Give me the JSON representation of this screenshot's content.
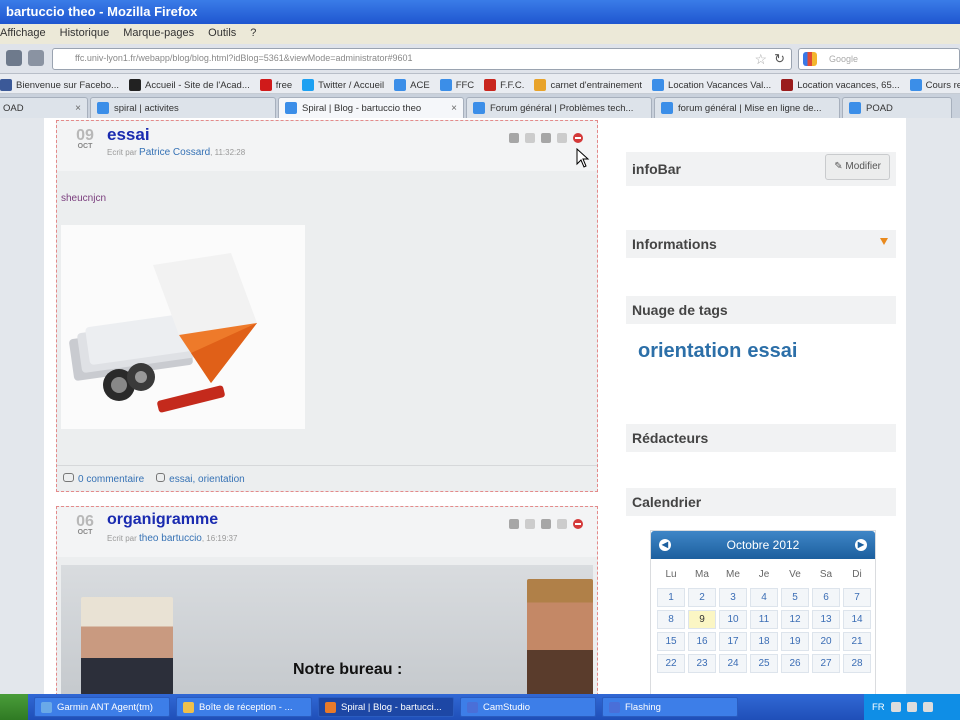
{
  "window": {
    "title": "bartuccio theo - Mozilla Firefox"
  },
  "menu": [
    "Affichage",
    "Historique",
    "Marque-pages",
    "Outils",
    "?"
  ],
  "navbar": {
    "url": "ffc.univ-lyon1.fr/webapp/blog/blog.html?idBlog=5361&viewMode=administrator#9601",
    "search_placeholder": "Google"
  },
  "bookmarks": [
    {
      "label": "Bienvenue sur Facebo...",
      "color": "#3b5998"
    },
    {
      "label": "Accueil - Site de l'Acad...",
      "color": "#222222"
    },
    {
      "label": "free",
      "color": "#d01a1a"
    },
    {
      "label": "Twitter / Accueil",
      "color": "#1da1f2"
    },
    {
      "label": "ACE",
      "color": "#3b8ee8"
    },
    {
      "label": "FFC",
      "color": "#3b8ee8"
    },
    {
      "label": "F.F.C.",
      "color": "#c9261e"
    },
    {
      "label": "carnet d'entrainement",
      "color": "#e8a32a"
    },
    {
      "label": "Location Vacances Val...",
      "color": "#3b8ee8"
    },
    {
      "label": "Location vacances, 65...",
      "color": "#9a1c1c"
    },
    {
      "label": "Cours rem...",
      "color": "#3b8ee8"
    }
  ],
  "tabs": [
    {
      "label": "OAD",
      "active": false
    },
    {
      "label": "spiral | activites",
      "active": false
    },
    {
      "label": "Spiral | Blog - bartuccio theo",
      "active": true
    },
    {
      "label": "Forum général | Problèmes tech...",
      "active": false
    },
    {
      "label": "forum général | Mise en ligne de...",
      "active": false
    },
    {
      "label": "POAD",
      "active": false
    }
  ],
  "posts": [
    {
      "day": "09",
      "month": "OCT",
      "title": "essai",
      "written_by": "Ecrit par",
      "author": "Patrice Cossard",
      "time": ", 11:32:28",
      "body": "sheucnjcn",
      "comments": "0 commentaire",
      "tags": "essai, orientation"
    },
    {
      "day": "06",
      "month": "OCT",
      "title": "organigramme",
      "written_by": "Ecrit par",
      "author": "theo bartuccio",
      "time": ", 16:19:37",
      "banner_text": "Notre bureau :"
    }
  ],
  "sidebar": {
    "infobar": {
      "title": "infoBar",
      "button": "Modifier"
    },
    "informations": {
      "title": "Informations"
    },
    "tags": {
      "title": "Nuage de tags",
      "items": [
        "orientation",
        "essai"
      ]
    },
    "redacteurs": {
      "title": "Rédacteurs"
    },
    "calendar": {
      "title": "Calendrier",
      "month_label": "Octobre 2012",
      "weekdays": [
        "Lu",
        "Ma",
        "Me",
        "Je",
        "Ve",
        "Sa",
        "Di"
      ],
      "days": [
        "1",
        "2",
        "3",
        "4",
        "5",
        "6",
        "7",
        "8",
        "9",
        "10",
        "11",
        "12",
        "13",
        "14",
        "15",
        "16",
        "17",
        "18",
        "19",
        "20",
        "21",
        "22",
        "23",
        "24",
        "25",
        "26",
        "27",
        "28"
      ],
      "today": "9"
    }
  },
  "taskbar": {
    "items": [
      {
        "label": "Garmin ANT Agent(tm)",
        "active": false
      },
      {
        "label": "Boîte de réception - ...",
        "active": false
      },
      {
        "label": "Spiral | Blog - bartucci...",
        "active": true
      },
      {
        "label": "CamStudio",
        "active": false
      },
      {
        "label": "Flashing",
        "active": false
      }
    ],
    "lang": "FR"
  }
}
